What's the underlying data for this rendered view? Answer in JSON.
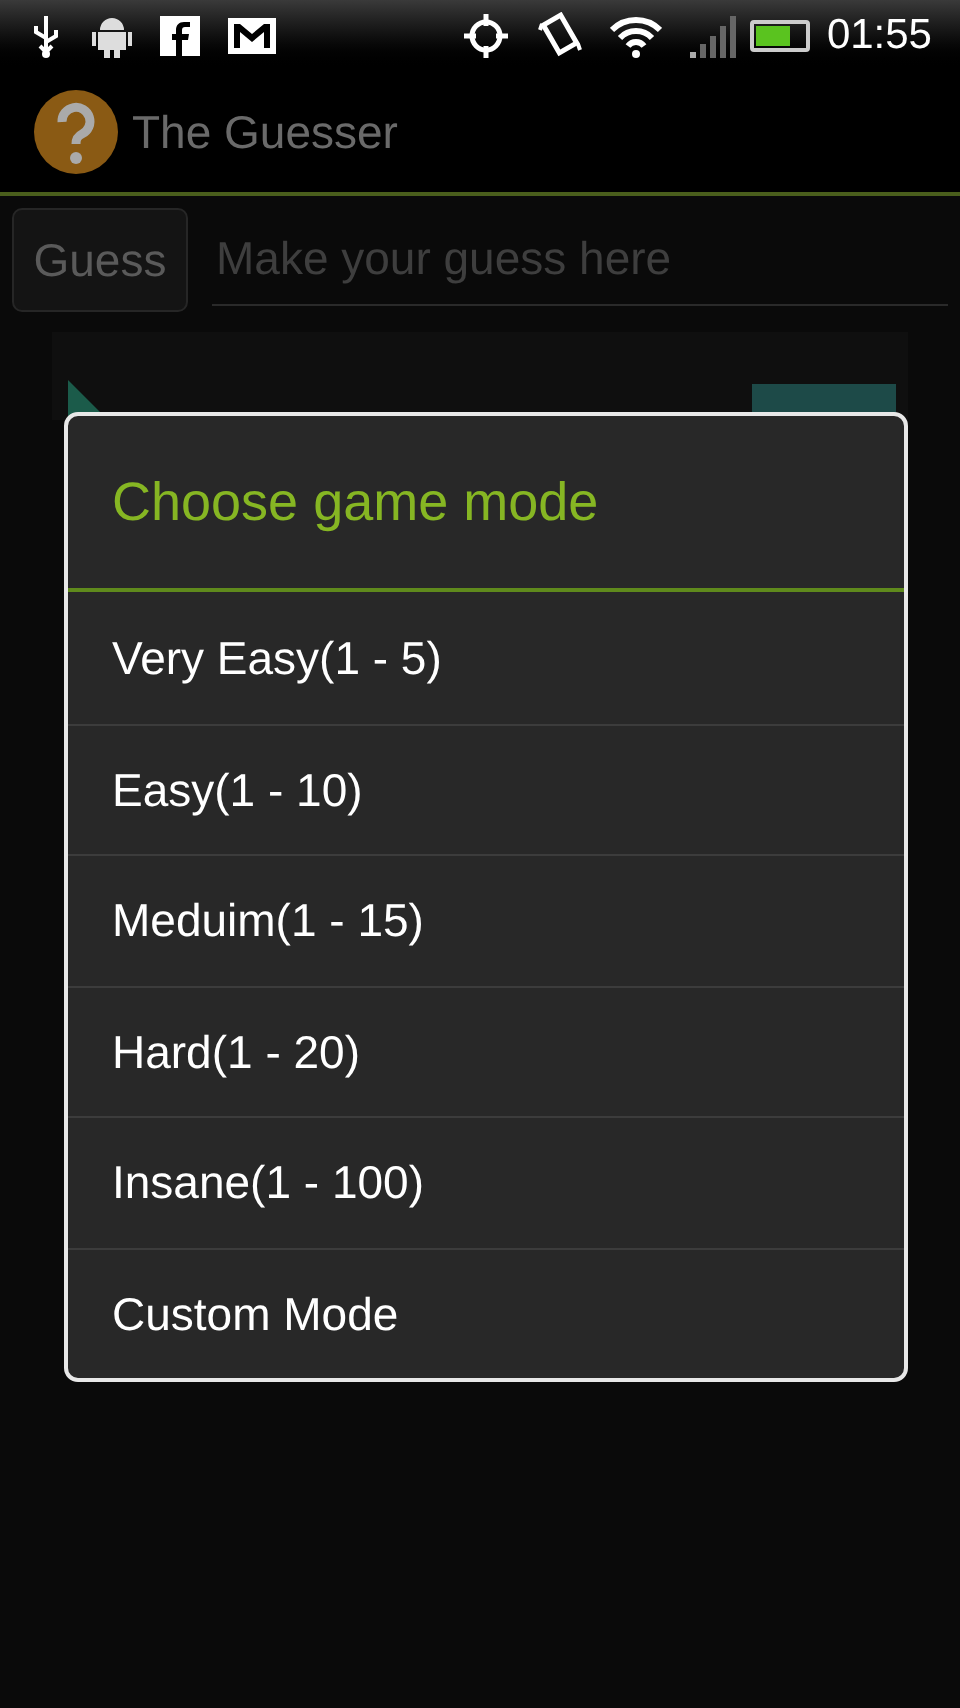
{
  "status_bar": {
    "time": "01:55"
  },
  "action_bar": {
    "title": "The Guesser"
  },
  "guess_button": {
    "label": "Guess"
  },
  "guess_field": {
    "placeholder": "Make your guess here"
  },
  "dialog": {
    "title": "Choose game mode",
    "items": [
      {
        "label": "Very Easy(1 - 5)"
      },
      {
        "label": "Easy(1 - 10)"
      },
      {
        "label": "Meduim(1 - 15)"
      },
      {
        "label": "Hard(1 - 20)"
      },
      {
        "label": "Insane(1 - 100)"
      },
      {
        "label": "Custom Mode"
      }
    ]
  }
}
